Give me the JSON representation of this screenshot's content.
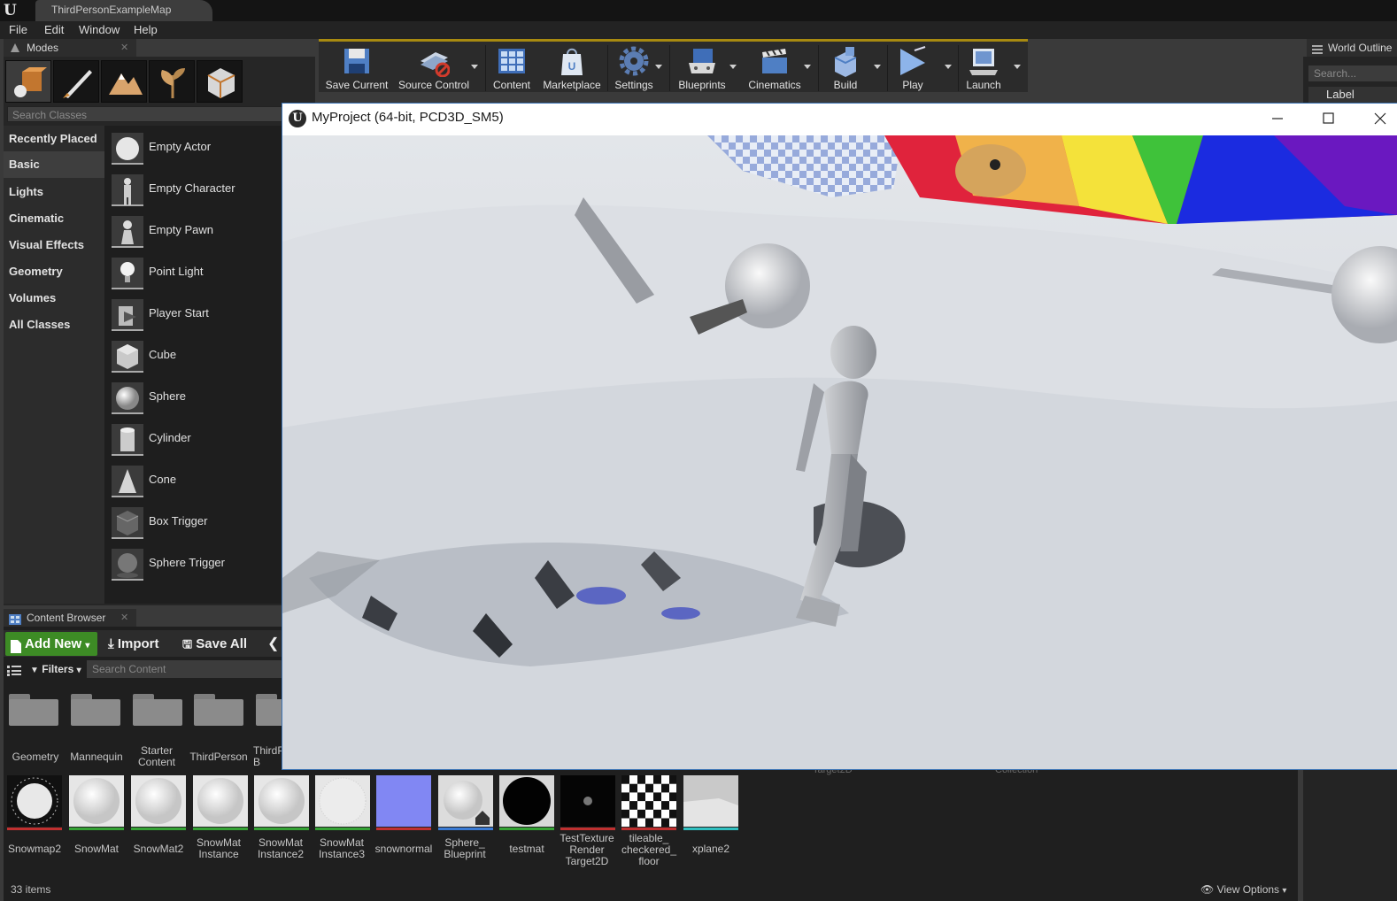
{
  "title_bar": {
    "level_tab": "ThirdPersonExampleMap"
  },
  "menu": [
    "File",
    "Edit",
    "Window",
    "Help"
  ],
  "modes": {
    "tab_label": "Modes",
    "search_placeholder": "Search Classes",
    "categories": [
      "Recently Placed",
      "Basic",
      "Lights",
      "Cinematic",
      "Visual Effects",
      "Geometry",
      "Volumes",
      "All Classes"
    ],
    "active_category": "Basic",
    "items": [
      "Empty Actor",
      "Empty Character",
      "Empty Pawn",
      "Point Light",
      "Player Start",
      "Cube",
      "Sphere",
      "Cylinder",
      "Cone",
      "Box Trigger",
      "Sphere Trigger"
    ]
  },
  "toolbar": {
    "buttons": [
      "Save Current",
      "Source Control",
      "Content",
      "Marketplace",
      "Settings",
      "Blueprints",
      "Cinematics",
      "Build",
      "Play",
      "Launch"
    ]
  },
  "world_outliner": {
    "tab_label": "World Outline",
    "search_placeholder": "Search...",
    "column": "Label"
  },
  "game_window": {
    "title": "MyProject (64-bit, PCD3D_SM5)"
  },
  "content_browser": {
    "tab_label": "Content Browser",
    "add_new": "Add New",
    "import": "Import",
    "save_all": "Save All",
    "filters": "Filters",
    "search_placeholder": "Search Content",
    "folders": [
      "Geometry",
      "Mannequin",
      "Starter Content",
      "ThirdPerson",
      "ThirdP B"
    ],
    "assets": [
      {
        "name": "Snowmap2",
        "color": "#c03030"
      },
      {
        "name": "SnowMat",
        "color": "#35a335"
      },
      {
        "name": "SnowMat2",
        "color": "#35a335"
      },
      {
        "name": "SnowMat Instance",
        "color": "#35a335"
      },
      {
        "name": "SnowMat Instance2",
        "color": "#35a335"
      },
      {
        "name": "SnowMat Instance3",
        "color": "#35a335"
      },
      {
        "name": "snownormal",
        "color": "#c03030"
      },
      {
        "name": "Sphere_ Blueprint",
        "color": "#3a7bd5"
      },
      {
        "name": "testmat",
        "color": "#35a335"
      },
      {
        "name": "TestTexture Render Target2D",
        "color": "#c03030"
      },
      {
        "name": "tileable_ checkered_ floor",
        "color": "#c03030"
      },
      {
        "name": "xplane2",
        "color": "#30c0c0"
      }
    ],
    "ghost_labels": [
      "Target2D",
      "Collection"
    ],
    "item_count": "33 items",
    "view_options": "View Options"
  }
}
